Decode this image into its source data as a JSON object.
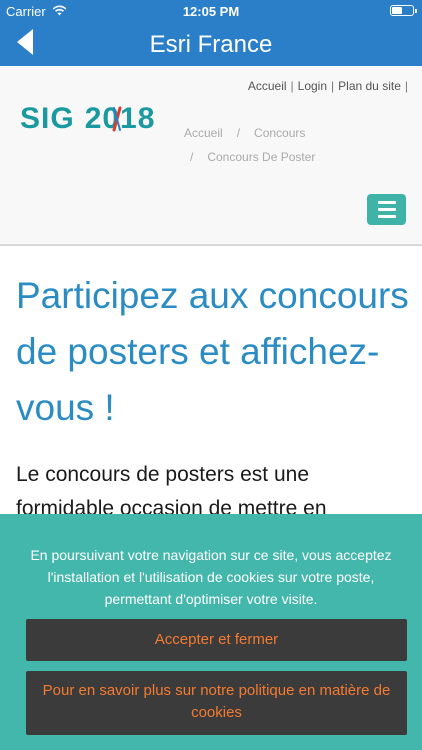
{
  "status_bar": {
    "carrier": "Carrier",
    "time": "12:05 PM"
  },
  "nav": {
    "title": "Esri France"
  },
  "header": {
    "top_links": [
      "Accueil",
      "Login",
      "Plan du site"
    ],
    "separator": "|",
    "logo_text_left": "SIG",
    "logo_text_right": "2018",
    "breadcrumb": [
      "Accueil",
      "Concours",
      "Concours De Poster"
    ],
    "breadcrumb_sep": "/"
  },
  "main": {
    "headline": "Participez aux concours de posters et affichez-vous !",
    "intro": "Le concours de posters est une formidable occasion de mettre en"
  },
  "cookie": {
    "message": "En poursuivant votre navigation sur ce site, vous acceptez l'installation et l'utilisation de cookies sur votre poste, permettant d'optimiser votre visite.",
    "accept_label": "Accepter et fermer",
    "more_label": "Pour en savoir plus sur notre politique en matière de cookies"
  },
  "colors": {
    "nav_blue": "#2a7fc8",
    "headline_blue": "#2b8cc4",
    "logo_teal": "#1a9aa0",
    "banner_teal": "#44b7ac",
    "button_dark": "#3b3b3b",
    "button_text_orange": "#f47a32"
  },
  "icons": {
    "back": "chevron-left-icon",
    "wifi": "wifi-icon",
    "battery": "battery-icon",
    "menu": "hamburger-menu-icon",
    "compass": "compass-icon"
  }
}
